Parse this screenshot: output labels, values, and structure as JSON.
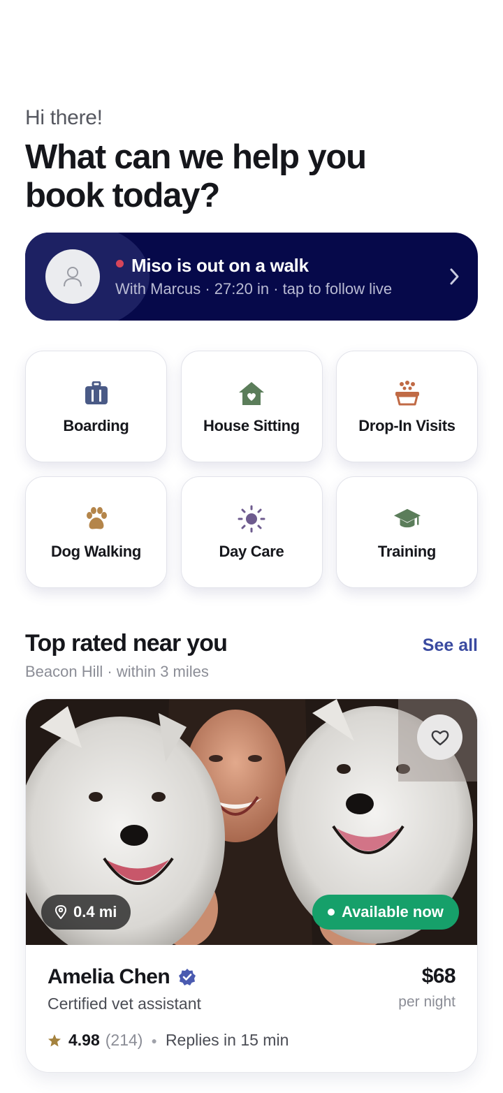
{
  "header": {
    "greeting": "Hi there!",
    "headline": "What can we help you book today?"
  },
  "walk_status": {
    "title": "Miso is out on a walk",
    "subtitle": "With Marcus · 27:20 in · tap to follow live",
    "live_dot_color": "#d6455a",
    "background_color": "#06094a"
  },
  "services": [
    {
      "label": "Boarding",
      "icon": "suitcase-icon",
      "color": "#4a5a86"
    },
    {
      "label": "House Sitting",
      "icon": "house-heart-icon",
      "color": "#5b7d5a"
    },
    {
      "label": "Drop-In Visits",
      "icon": "food-bowl-icon",
      "color": "#c06a45"
    },
    {
      "label": "Dog Walking",
      "icon": "paw-icon",
      "color": "#b4854a"
    },
    {
      "label": "Day Care",
      "icon": "sun-icon",
      "color": "#6e5b8e"
    },
    {
      "label": "Training",
      "icon": "graduation-cap-icon",
      "color": "#5b7d5a"
    }
  ],
  "top_rated": {
    "title": "Top rated near you",
    "subtitle": "Beacon Hill · within 3 miles",
    "see_all": "See all"
  },
  "sitter_card": {
    "distance": "0.4 mi",
    "availability": "Available now",
    "name": "Amelia Chen",
    "verified": true,
    "role": "Certified vet assistant",
    "price": "$68",
    "price_unit": "per night",
    "rating": "4.98",
    "review_count": "(214)",
    "reply_time": "Replies in 15 min",
    "accent_color": "#16a06a"
  }
}
